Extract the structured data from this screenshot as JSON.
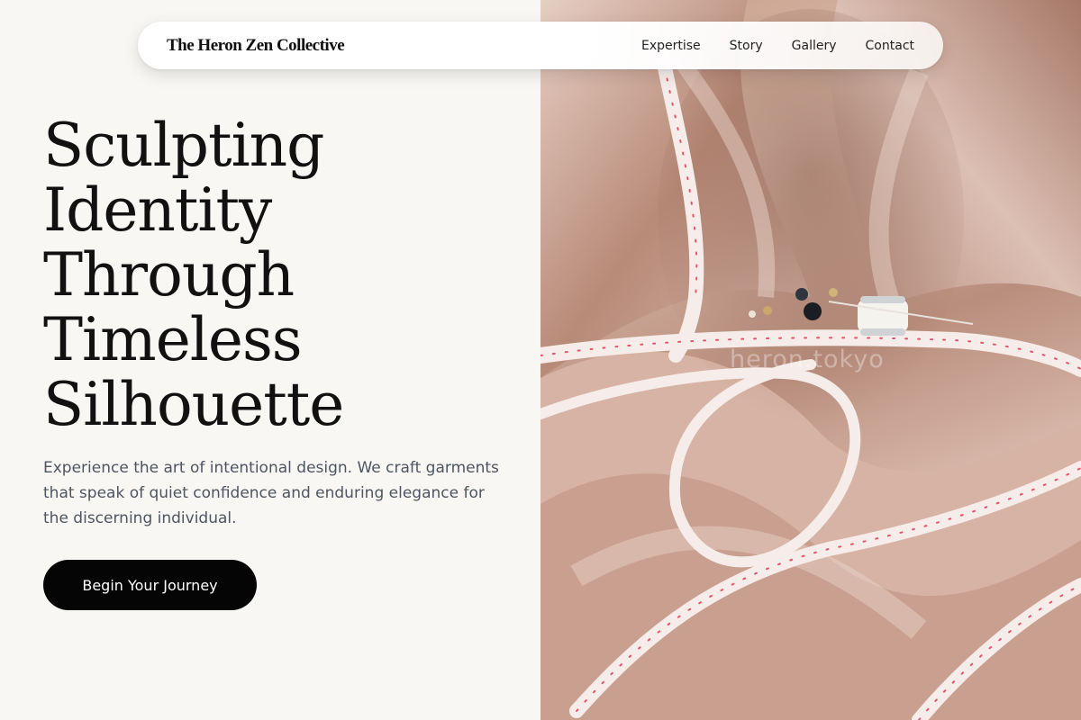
{
  "nav": {
    "brand": "The Heron Zen Collective",
    "links": [
      "Expertise",
      "Story",
      "Gallery",
      "Contact"
    ]
  },
  "hero": {
    "headline_lines": [
      "Sculpting",
      "Identity",
      "Through",
      "Timeless",
      "Silhouette"
    ],
    "subtext": "Experience the art of intentional design. We craft garments that speak of quiet confidence and enduring elegance for the discerning individual.",
    "cta_label": "Begin Your Journey"
  },
  "image": {
    "watermark": "heron.tokyo"
  },
  "colors": {
    "background": "#f8f7f4",
    "text": "#111111",
    "subtext": "#4e5561",
    "button": "#050505",
    "fabric": "#c9a08c",
    "tape": "#f4e8e6",
    "tape_marks": "#e0556a"
  }
}
